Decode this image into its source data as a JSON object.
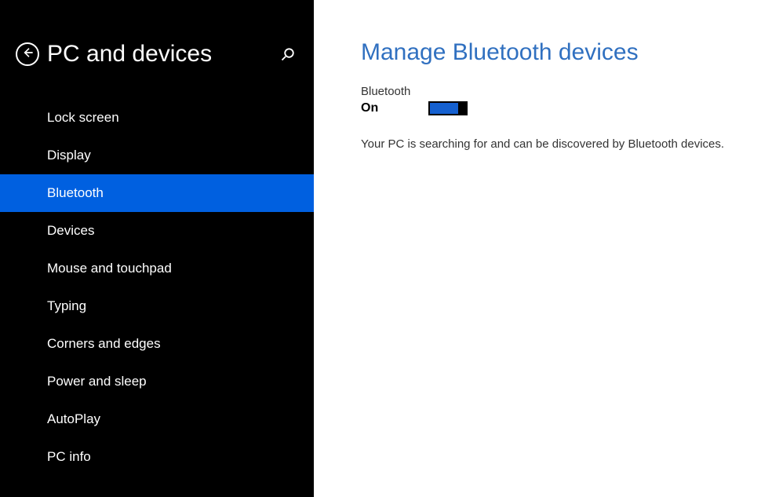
{
  "sidebar": {
    "title": "PC and devices",
    "items": [
      {
        "label": "Lock screen",
        "selected": false
      },
      {
        "label": "Display",
        "selected": false
      },
      {
        "label": "Bluetooth",
        "selected": true
      },
      {
        "label": "Devices",
        "selected": false
      },
      {
        "label": "Mouse and touchpad",
        "selected": false
      },
      {
        "label": "Typing",
        "selected": false
      },
      {
        "label": "Corners and edges",
        "selected": false
      },
      {
        "label": "Power and sleep",
        "selected": false
      },
      {
        "label": "AutoPlay",
        "selected": false
      },
      {
        "label": "PC info",
        "selected": false
      }
    ]
  },
  "main": {
    "title": "Manage Bluetooth devices",
    "setting_label": "Bluetooth",
    "toggle_status": "On",
    "status_text": "Your PC is searching for and can be discovered by Bluetooth devices."
  }
}
